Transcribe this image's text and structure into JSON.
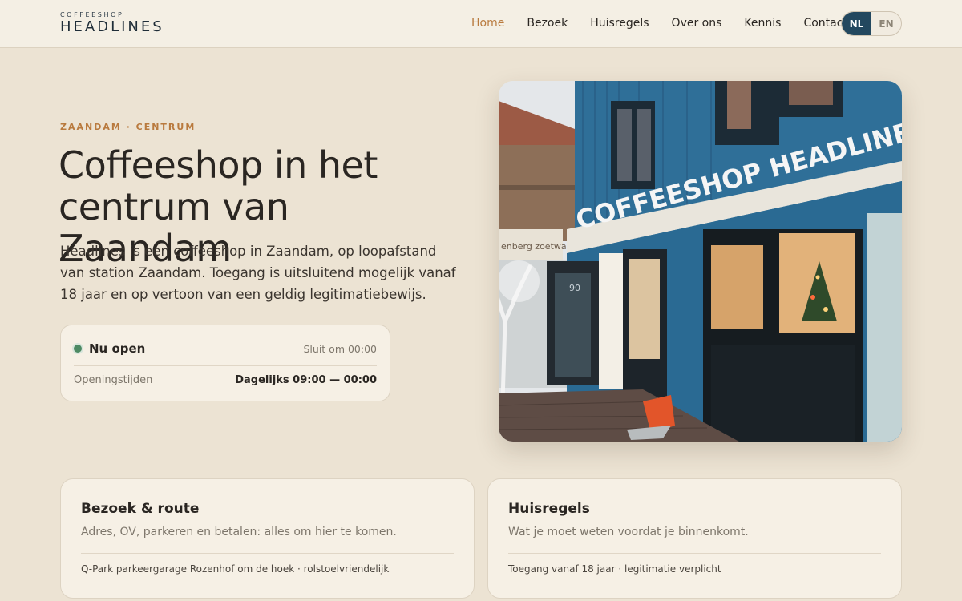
{
  "brand": {
    "top": "COFFEESHOP",
    "main": "HEADLINES"
  },
  "nav": {
    "items": [
      "Home",
      "Bezoek",
      "Huisregels",
      "Over ons",
      "Kennis",
      "Contact"
    ],
    "active": "Home"
  },
  "language": {
    "active": "NL",
    "other": "EN"
  },
  "hero": {
    "eyebrow": "ZAANDAM · CENTRUM",
    "title": "Coffeeshop in het centrum van Zaandam",
    "lead": "Headlines is een coffeeshop in Zaandam, op loopafstand van station Zaandam. Toegang is uitsluitend mogelijk vanaf 18 jaar en op vertoon van een geldig legitimatiebewijs."
  },
  "status": {
    "open_label": "Nu open",
    "close_text": "Sluit om 00:00",
    "hours_label": "Openingstijden",
    "hours_value": "Dagelijks 09:00 — 00:00",
    "status_color": "#4d8a63"
  },
  "photo": {
    "sign_text": "COFFEESHOP HEADLINES",
    "house_number": "90",
    "neighbor_sign": "enberg zoetwaren"
  },
  "cards": [
    {
      "title": "Bezoek & route",
      "subtitle": "Adres, OV, parkeren en betalen: alles om hier te komen.",
      "meta": "Q-Park parkeergarage Rozenhof om de hoek · rolstoelvriendelijk"
    },
    {
      "title": "Huisregels",
      "subtitle": "Wat je moet weten voordat je binnenkomt.",
      "meta": "Toegang vanaf 18 jaar · legitimatie verplicht"
    }
  ],
  "colors": {
    "accent": "#b97a3e",
    "brand_dark": "#23485f",
    "background": "#ece3d3",
    "card": "#f6f0e5"
  }
}
